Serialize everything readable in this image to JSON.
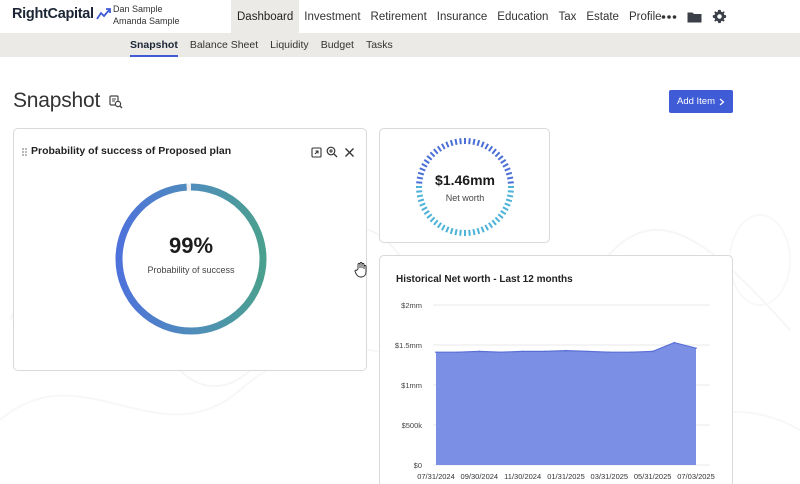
{
  "brand": {
    "name": "RightCapital",
    "accent": "#3f5bd6"
  },
  "clients": [
    "Dan Sample",
    "Amanda Sample"
  ],
  "nav": {
    "items": [
      "Dashboard",
      "Investment",
      "Retirement",
      "Insurance",
      "Education",
      "Tax",
      "Estate",
      "Profile"
    ],
    "active": "Dashboard",
    "icons": [
      "more-icon",
      "folder-icon",
      "gear-icon"
    ]
  },
  "subnav": {
    "items": [
      "Snapshot",
      "Balance Sheet",
      "Liquidity",
      "Budget",
      "Tasks"
    ],
    "active": "Snapshot"
  },
  "page": {
    "title": "Snapshot",
    "add_button": "Add Item"
  },
  "probability_card": {
    "title": "Probability of success of Proposed plan",
    "value": "99%",
    "label": "Probability of success",
    "progress": 0.99
  },
  "net_worth_card": {
    "value": "$1.46mm",
    "label": "Net worth"
  },
  "history_card": {
    "title": "Historical Net worth - Last 12 months"
  },
  "chart_data": {
    "type": "area",
    "title": "Historical Net worth - Last 12 months",
    "x": [
      "07/31/2024",
      "08/31/2024",
      "09/30/2024",
      "10/31/2024",
      "11/30/2024",
      "12/31/2024",
      "01/31/2025",
      "02/28/2025",
      "03/31/2025",
      "04/30/2025",
      "05/31/2025",
      "06/30/2025",
      "07/03/2025"
    ],
    "values": [
      1.41,
      1.41,
      1.42,
      1.41,
      1.42,
      1.42,
      1.43,
      1.42,
      1.41,
      1.41,
      1.42,
      1.53,
      1.46
    ],
    "x_tick_labels": [
      "07/31/2024",
      "09/30/2024",
      "11/30/2024",
      "01/31/2025",
      "03/31/2025",
      "05/31/2025",
      "07/03/2025"
    ],
    "y_tick_labels": [
      "$0",
      "$500k",
      "$1mm",
      "$1.5mm",
      "$2mm"
    ],
    "y_ticks": [
      0,
      0.5,
      1,
      1.5,
      2
    ],
    "ylim": [
      0,
      2
    ],
    "unit": "millions USD",
    "grid": true,
    "color": "#7b8fe4"
  }
}
